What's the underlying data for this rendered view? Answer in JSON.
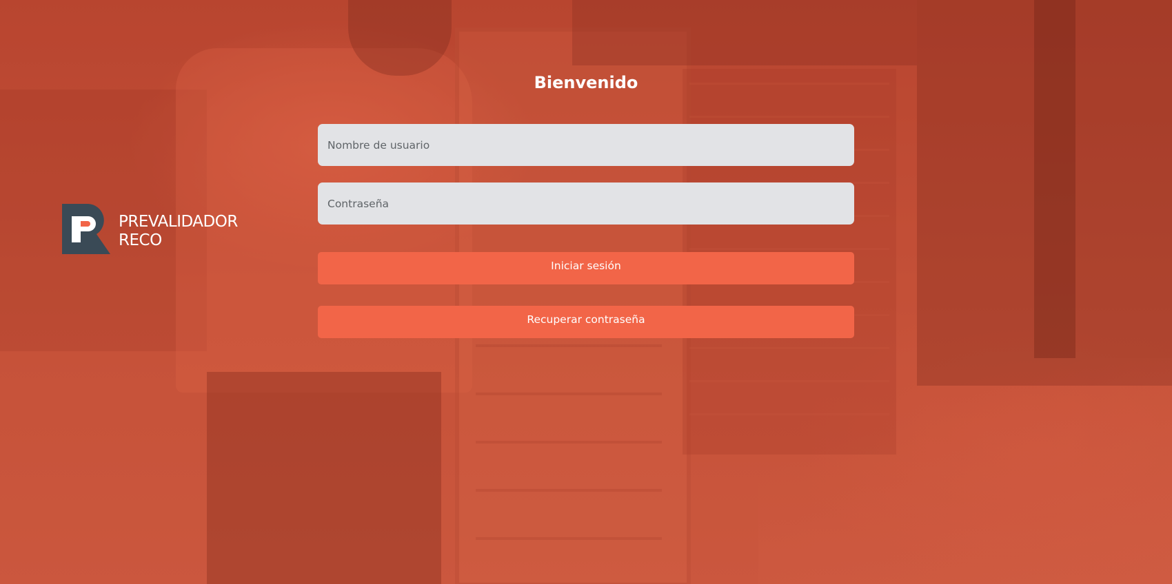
{
  "app": {
    "name_line1": "PREVALIDADOR",
    "name_line2": "RECO"
  },
  "login": {
    "title": "Bienvenido",
    "username_placeholder": "Nombre de usuario",
    "password_placeholder": "Contraseña",
    "login_button": "Iniciar sesión",
    "recover_button": "Recuperar contraseña"
  },
  "colors": {
    "background_tint": "#b84a35",
    "button": "#f26548",
    "input_background": "#e2e3e6",
    "logo_dark": "#3a4a56",
    "logo_accent": "#f26548"
  },
  "icons": {
    "logo": "reco-r-logo-icon"
  }
}
